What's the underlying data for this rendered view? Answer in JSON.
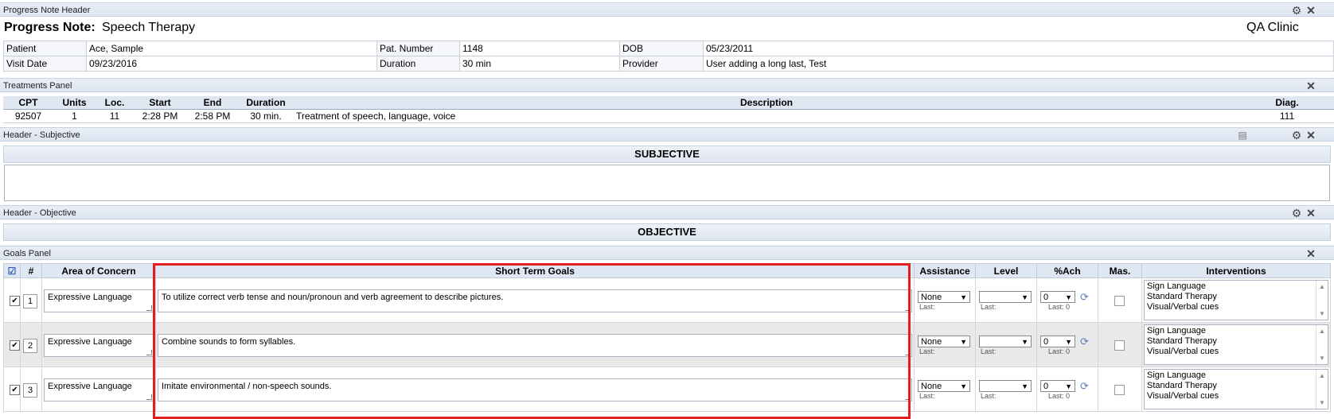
{
  "header_panel": {
    "label": "Progress Note Header"
  },
  "title": {
    "label": "Progress Note:",
    "value": "Speech Therapy",
    "clinic": "QA Clinic"
  },
  "info": {
    "patient_label": "Patient",
    "patient": "Ace, Sample",
    "pat_number_label": "Pat. Number",
    "pat_number": "1148",
    "dob_label": "DOB",
    "dob": "05/23/2011",
    "visit_date_label": "Visit Date",
    "visit_date": "09/23/2016",
    "duration_label": "Duration",
    "duration": "30 min",
    "provider_label": "Provider",
    "provider": "User adding a long last, Test"
  },
  "treatments": {
    "panel_label": "Treatments Panel",
    "columns": [
      "CPT",
      "Units",
      "Loc.",
      "Start",
      "End",
      "Duration",
      "Description",
      "Diag."
    ],
    "rows": [
      [
        "92507",
        "1",
        "11",
        "2:28 PM",
        "2:58 PM",
        "30 min.",
        "Treatment of speech, language, voice",
        "111"
      ]
    ]
  },
  "subjective": {
    "panel_label": "Header - Subjective",
    "section_title": "SUBJECTIVE"
  },
  "objective": {
    "panel_label": "Header - Objective",
    "section_title": "OBJECTIVE"
  },
  "goals": {
    "panel_label": "Goals Panel",
    "columns": {
      "num": "#",
      "area": "Area of Concern",
      "stg": "Short Term Goals",
      "assistance": "Assistance",
      "level": "Level",
      "pct": "%Ach",
      "mas": "Mas.",
      "interventions": "Interventions"
    },
    "last_label": "Last:",
    "rows": [
      {
        "num": "1",
        "area": "Expressive Language",
        "goal": "To utilize correct verb tense and noun/pronoun and verb agreement to describe pictures.",
        "assistance": "None",
        "level": "",
        "pct": "0",
        "pct_last": "Last: 0",
        "interventions": [
          "Sign Language",
          "Standard Therapy",
          "Visual/Verbal cues"
        ]
      },
      {
        "num": "2",
        "area": "Expressive Language",
        "goal": "Combine sounds to form syllables.",
        "assistance": "None",
        "level": "",
        "pct": "0",
        "pct_last": "Last: 0",
        "interventions": [
          "Sign Language",
          "Standard Therapy",
          "Visual/Verbal cues"
        ]
      },
      {
        "num": "3",
        "area": "Expressive Language",
        "goal": "Imitate environmental / non-speech sounds.",
        "assistance": "None",
        "level": "",
        "pct": "0",
        "pct_last": "Last: 0",
        "interventions": [
          "Sign Language",
          "Standard Therapy",
          "Visual/Verbal cues"
        ]
      }
    ]
  },
  "icons": {
    "gear": "gear-icon",
    "close": "close-icon",
    "notes": "notes-icon",
    "refresh": "refresh-icon",
    "check-all": "check-all-icon"
  }
}
